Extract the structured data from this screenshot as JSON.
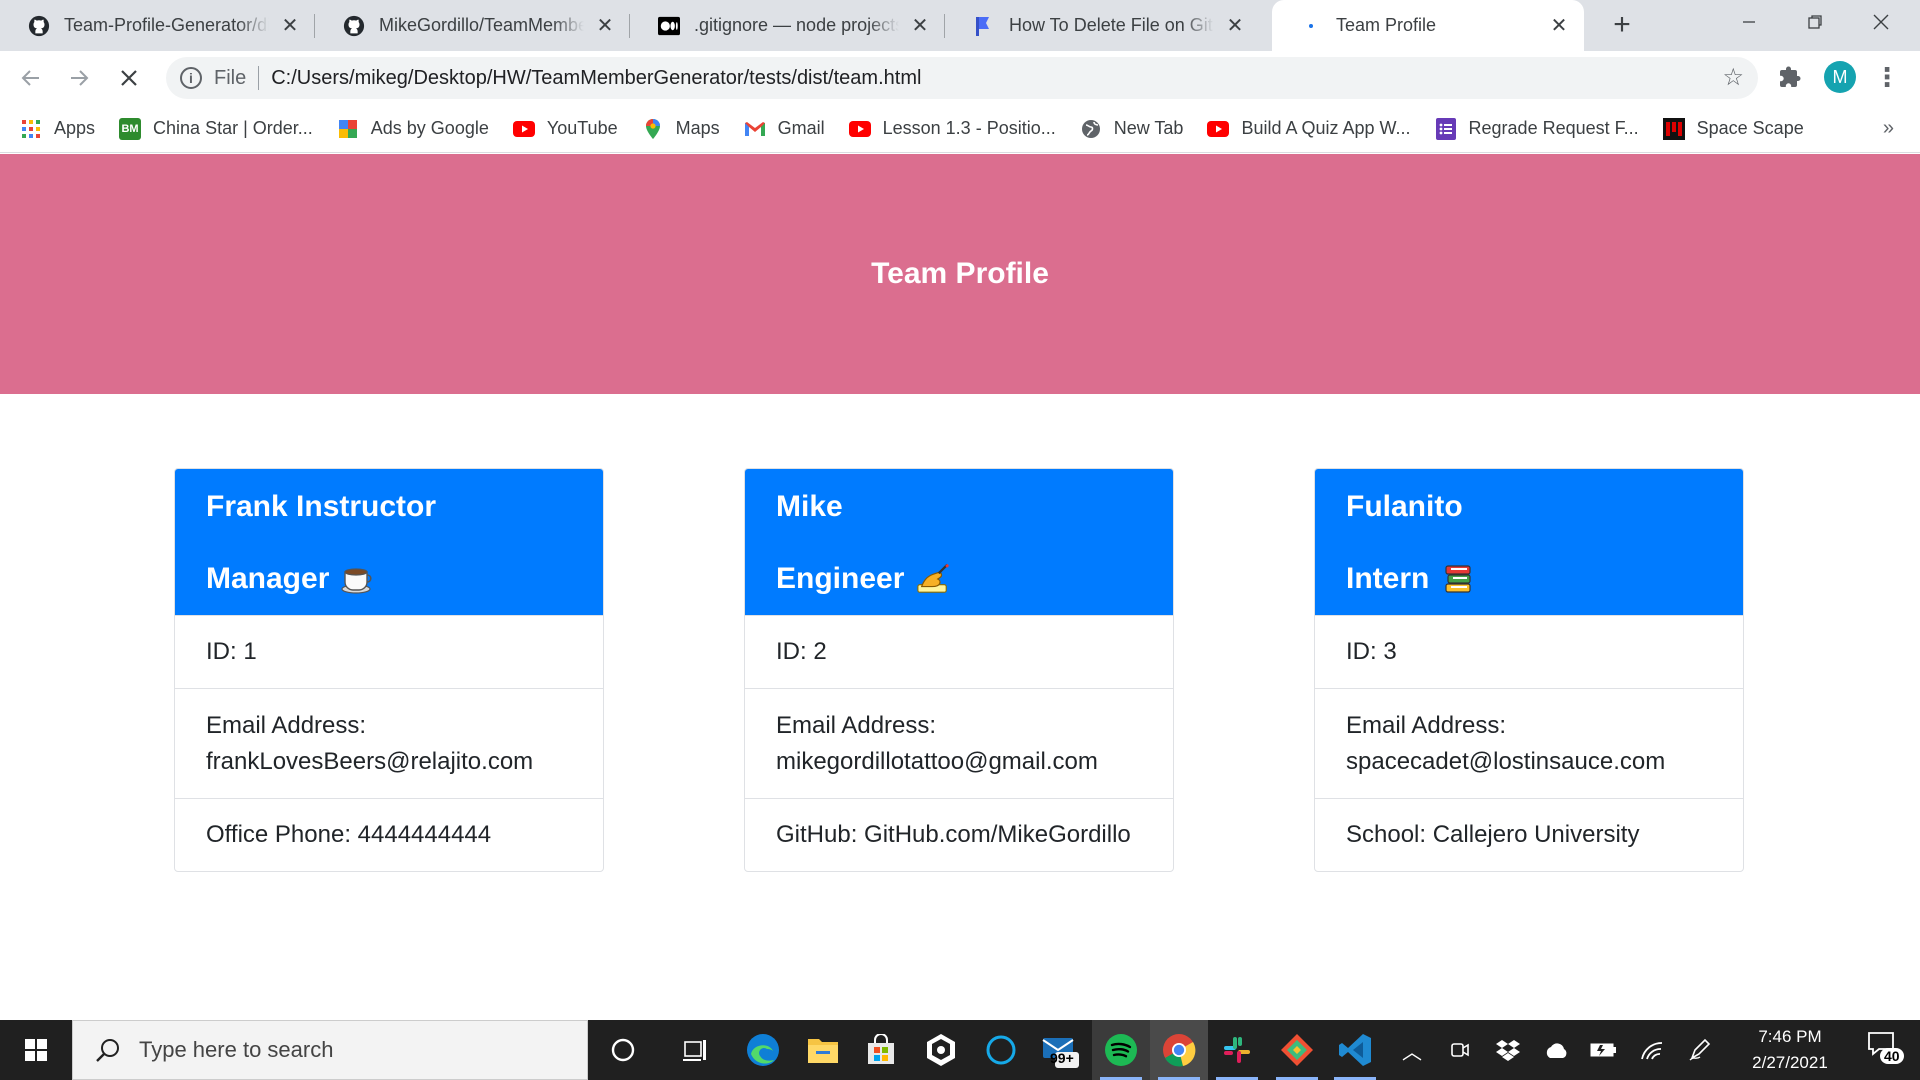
{
  "browser": {
    "tabs": [
      {
        "title": "Team-Profile-Generator/dist",
        "favicon": "github-icon"
      },
      {
        "title": "MikeGordillo/TeamMember",
        "favicon": "github-icon"
      },
      {
        "title": ".gitignore — node projects",
        "favicon": "medium-icon"
      },
      {
        "title": "How To Delete File on Git –",
        "favicon": "bookmark-flag-icon"
      },
      {
        "title": "Team Profile",
        "favicon": "loading-icon"
      }
    ],
    "active_tab": 4,
    "url_scheme": "File",
    "url": "C:/Users/mikeg/Desktop/HW/TeamMemberGenerator/tests/dist/team.html",
    "profile_initial": "M",
    "bookmarks": [
      {
        "label": "Apps",
        "icon": "apps-grid-icon"
      },
      {
        "label": "China Star | Order...",
        "icon": "beyondmenu-icon",
        "icon_text": "BM",
        "color": "#2e8b2e"
      },
      {
        "label": "Ads by Google",
        "icon": "google-ads-icon"
      },
      {
        "label": "YouTube",
        "icon": "youtube-icon"
      },
      {
        "label": "Maps",
        "icon": "maps-pin-icon"
      },
      {
        "label": "Gmail",
        "icon": "gmail-icon"
      },
      {
        "label": "Lesson 1.3 - Positio...",
        "icon": "youtube-icon"
      },
      {
        "label": "New Tab",
        "icon": "globe-icon"
      },
      {
        "label": "Build A Quiz App W...",
        "icon": "youtube-icon"
      },
      {
        "label": "Regrade Request F...",
        "icon": "forms-icon"
      },
      {
        "label": "Space Scape",
        "icon": "space-scape-icon"
      }
    ],
    "bookmarks_overflow": "»"
  },
  "page": {
    "heading": "Team Profile",
    "header_color": "#db6e8f",
    "card_color": "#007bff",
    "cards": [
      {
        "name": "Frank Instructor",
        "role": "Manager",
        "role_icon": "coffee-cup-icon",
        "id": "ID: 1",
        "email_label": "Email Address:",
        "email": "frankLovesBeers@relajito.com",
        "extra": "Office Phone: 4444444444"
      },
      {
        "name": "Mike",
        "role": "Engineer",
        "role_icon": "writing-hand-icon",
        "id": "ID: 2",
        "email_label": "Email Address:",
        "email": "mikegordillotattoo@gmail.com",
        "extra": "GitHub: GitHub.com/MikeGordillo"
      },
      {
        "name": "Fulanito",
        "role": "Intern",
        "role_icon": "books-icon",
        "id": "ID: 3",
        "email_label": "Email Address:",
        "email": "spacecadet@lostinsauce.com",
        "extra": "School: Callejero University"
      }
    ]
  },
  "taskbar": {
    "search_placeholder": "Type here to search",
    "mail_badge": "99+",
    "time": "7:46 PM",
    "date": "2/27/2021",
    "notification_count": "40"
  }
}
